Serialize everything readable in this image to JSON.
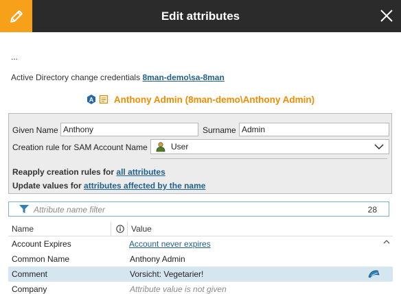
{
  "header": {
    "title": "Edit attributes",
    "edit_icon": "pencil-icon",
    "close_icon": "close-icon"
  },
  "ellipsis": "...",
  "credentials": {
    "label": "Active Directory change credentials",
    "account": "8man-demo\\sa-8man"
  },
  "user": {
    "display": "Anthony Admin (8man-demo\\Anthony Admin)",
    "icons": [
      "active-directory-icon",
      "user-card-icon"
    ]
  },
  "form": {
    "given_name_label": "Given Name",
    "given_name_value": "Anthony",
    "surname_label": "Surname",
    "surname_value": "Admin",
    "creation_rule_label": "Creation rule for SAM Account Name",
    "creation_rule_value": "User",
    "reapply_text": "Reapply creation rules for",
    "reapply_link": "all attributes",
    "update_text": "Update values for",
    "update_link": "attributes affected by the name"
  },
  "filter": {
    "placeholder": "Attribute name filter",
    "count": "28"
  },
  "table": {
    "columns": [
      "Name",
      "Value"
    ],
    "rows": [
      {
        "name": "Account Expires",
        "value": "Account never expires"
      },
      {
        "name": "Common Name",
        "value": "Anthony Admin"
      },
      {
        "name": "Comment",
        "value": "Vorsicht: Vegetarier!"
      },
      {
        "name": "Company",
        "value": "Attribute value is not given"
      }
    ]
  },
  "colors": {
    "accent": "#f7a11a",
    "titlebar": "#2b2b2b",
    "link": "#1f5f8b",
    "user_name": "#f08c00",
    "selected_row": "#d6e6f1"
  }
}
